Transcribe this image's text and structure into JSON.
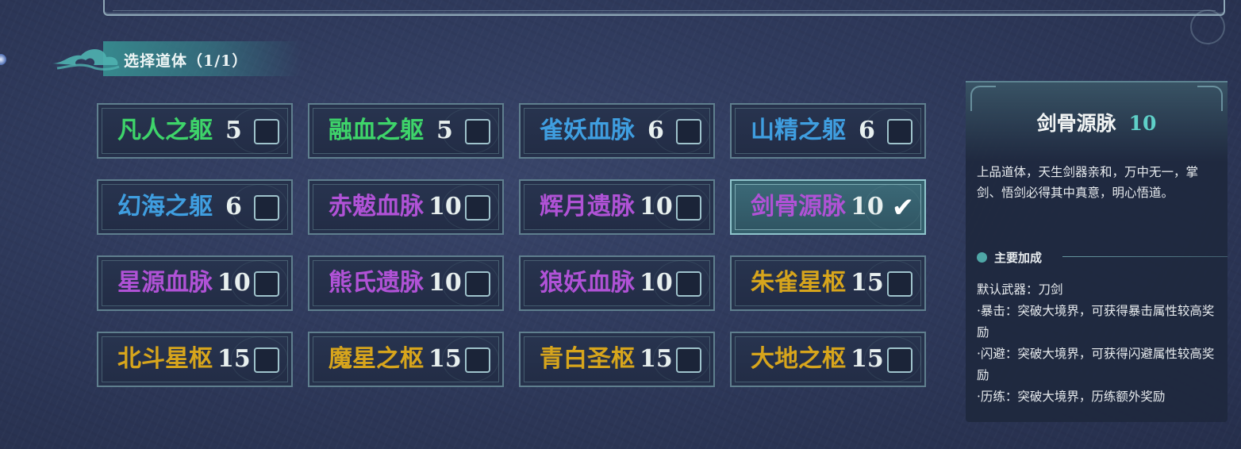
{
  "header": {
    "title": "选择道体（1/1）"
  },
  "options": [
    {
      "name": "凡人之躯",
      "num": "5",
      "color": "#3ed46a",
      "selected": false
    },
    {
      "name": "融血之躯",
      "num": "5",
      "color": "#3ed46a",
      "selected": false
    },
    {
      "name": "雀妖血脉",
      "num": "6",
      "color": "#3f9ee0",
      "selected": false
    },
    {
      "name": "山精之躯",
      "num": "6",
      "color": "#3f9ee0",
      "selected": false
    },
    {
      "name": "幻海之躯",
      "num": "6",
      "color": "#3f9ee0",
      "selected": false
    },
    {
      "name": "赤魃血脉",
      "num": "10",
      "color": "#b052d6",
      "selected": false
    },
    {
      "name": "辉月遗脉",
      "num": "10",
      "color": "#b052d6",
      "selected": false
    },
    {
      "name": "剑骨源脉",
      "num": "10",
      "color": "#b052d6",
      "selected": true
    },
    {
      "name": "星源血脉",
      "num": "10",
      "color": "#b052d6",
      "selected": false
    },
    {
      "name": "熊氏遗脉",
      "num": "10",
      "color": "#b052d6",
      "selected": false
    },
    {
      "name": "狼妖血脉",
      "num": "10",
      "color": "#b052d6",
      "selected": false
    },
    {
      "name": "朱雀星枢",
      "num": "15",
      "color": "#d7a51c",
      "selected": false
    },
    {
      "name": "北斗星枢",
      "num": "15",
      "color": "#d7a51c",
      "selected": false
    },
    {
      "name": "魔星之枢",
      "num": "15",
      "color": "#d7a51c",
      "selected": false
    },
    {
      "name": "青白圣枢",
      "num": "15",
      "color": "#d7a51c",
      "selected": false
    },
    {
      "name": "大地之枢",
      "num": "15",
      "color": "#d7a51c",
      "selected": false
    }
  ],
  "checkmark_glyph": "✔",
  "detail": {
    "title": "剑骨源脉",
    "num": "10",
    "description": "上品道体，天生剑器亲和，万中无一，掌剑、悟剑必得其中真意，明心悟道。",
    "bonus_heading": "主要加成",
    "bonus_lines": [
      "默认武器：刀剑",
      "·暴击：突破大境界，可获得暴击属性较高奖励",
      "·闪避：突破大境界，可获得闪避属性较高奖励",
      "·历练：突破大境界，历练额外奖励"
    ]
  }
}
